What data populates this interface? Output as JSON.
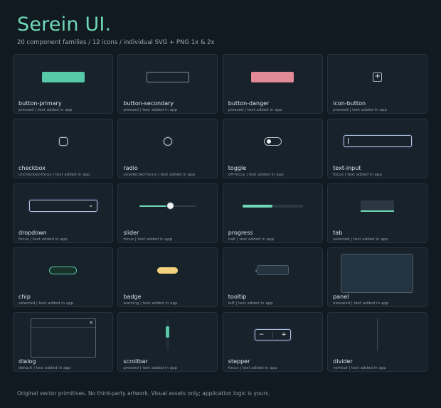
{
  "header": {
    "title": "Serein UI.",
    "subtitle": "20 component families  /  12 icons  /  individual SVG + PNG 1x & 2x"
  },
  "colors": {
    "background": "#111a21",
    "accent": "#6fd8b6",
    "primary": "#58c9a8",
    "danger": "#e38a99",
    "warning": "#f4d27d",
    "focus": "#b9c4e4"
  },
  "cards": [
    {
      "name": "button-primary",
      "meta": "pressed  |  text added in app"
    },
    {
      "name": "button-secondary",
      "meta": "pressed  |  text added in app"
    },
    {
      "name": "button-danger",
      "meta": "pressed  |  text added in app"
    },
    {
      "name": "icon-button",
      "meta": "pressed  |  text added in app"
    },
    {
      "name": "checkbox",
      "meta": "unchecked-focus  |  text added in app"
    },
    {
      "name": "radio",
      "meta": "unselected-focus  |  text added in app"
    },
    {
      "name": "toggle",
      "meta": "off-focus  |  text added in app"
    },
    {
      "name": "text-input",
      "meta": "focus  |  text added in app"
    },
    {
      "name": "dropdown",
      "meta": "focus  |  text added in app"
    },
    {
      "name": "slider",
      "meta": "focus  |  text added in app"
    },
    {
      "name": "progress",
      "meta": "half  |  text added in app"
    },
    {
      "name": "tab",
      "meta": "selected  |  text added in app"
    },
    {
      "name": "chip",
      "meta": "selected  |  text added in app"
    },
    {
      "name": "badge",
      "meta": "warning  |  text added in app"
    },
    {
      "name": "tooltip",
      "meta": "left  |  text added in app"
    },
    {
      "name": "panel",
      "meta": "elevated  |  text added in app"
    },
    {
      "name": "dialog",
      "meta": "default  |  text added in app"
    },
    {
      "name": "scrollbar",
      "meta": "pressed  |  text added in app"
    },
    {
      "name": "stepper",
      "meta": "focus  |  text added in app"
    },
    {
      "name": "divider",
      "meta": "vertical  |  text added in app"
    }
  ],
  "previews": {
    "icon_button_glyph": "+",
    "dropdown_chevron": "⌄",
    "dialog_close": "×",
    "stepper_minus": "−",
    "stepper_plus": "+",
    "slider_value": 0.55,
    "progress_value": 0.5
  },
  "footer": "Original vector primitives. No third-party artwork. Visual assets only; application logic is yours."
}
